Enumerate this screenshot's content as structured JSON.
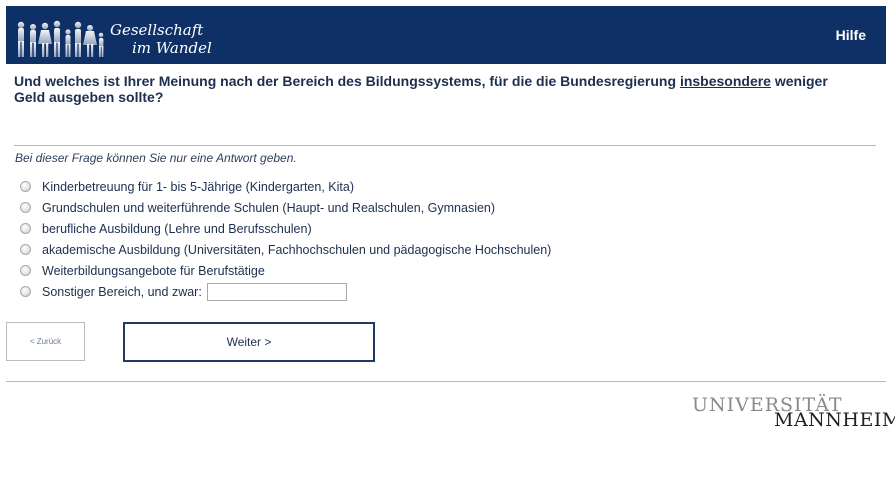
{
  "header": {
    "logo_line1": "Gesellschaft",
    "logo_line2": "im Wandel",
    "help_label": "Hilfe",
    "background_color": "#0f3066"
  },
  "question": {
    "text_before": "Und welches ist Ihrer Meinung nach der Bereich des Bildungssystems, für die die Bundesregierung ",
    "emphasis": "insbesondere",
    "text_after": " weniger Geld ausgeben sollte?"
  },
  "instruction": "Bei dieser Frage können Sie nur eine Antwort geben.",
  "options": [
    {
      "label": "Kinderbetreuung für 1- bis 5-Jährige (Kindergarten, Kita)",
      "selected": false
    },
    {
      "label": "Grundschulen und weiterführende Schulen (Haupt- und Realschulen, Gymnasien)",
      "selected": false
    },
    {
      "label": "berufliche Ausbildung (Lehre und Berufsschulen)",
      "selected": false
    },
    {
      "label": "akademische Ausbildung (Universitäten, Fachhochschulen und pädagogische Hochschulen)",
      "selected": false
    },
    {
      "label": "Weiterbildungsangebote für Berufstätige",
      "selected": false
    },
    {
      "label": "Sonstiger Bereich, und zwar:",
      "selected": false,
      "other_value": ""
    }
  ],
  "navigation": {
    "back_label": "< Zurück",
    "next_label": "Weiter >"
  },
  "footer": {
    "logo_line1": "UNIVERSITÄT",
    "logo_line2": "MANNHEIM"
  }
}
